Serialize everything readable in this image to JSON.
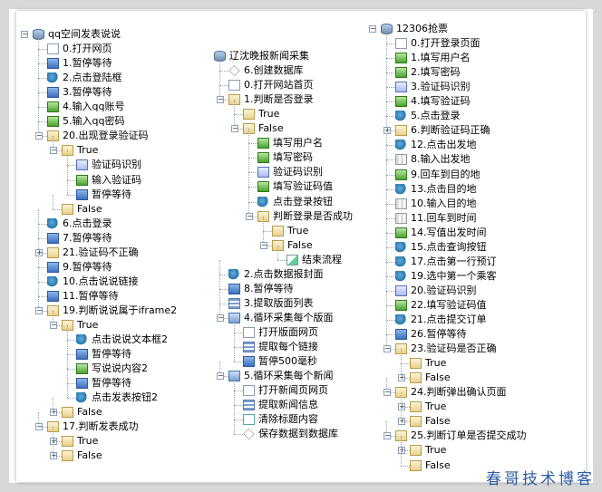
{
  "watermark": "春哥技术博客",
  "trees": [
    {
      "rows": [
        {
          "t": "qq空间发表说说",
          "icon": "db",
          "lvl": 0,
          "exp": "-"
        },
        {
          "t": "0.打开网页",
          "icon": "doc",
          "lvl": 1
        },
        {
          "t": "1.暂停等待",
          "icon": "pause",
          "lvl": 1
        },
        {
          "t": "2.点击登陆框",
          "icon": "click",
          "lvl": 1
        },
        {
          "t": "3.暂停等待",
          "icon": "pause",
          "lvl": 1
        },
        {
          "t": "4.输入qq账号",
          "icon": "green",
          "lvl": 1
        },
        {
          "t": "5.输入qq密码",
          "icon": "green",
          "lvl": 1
        },
        {
          "t": "20.出现登录验证码",
          "icon": "folder",
          "lvl": 1,
          "exp": "-"
        },
        {
          "t": "True",
          "icon": "folder",
          "lvl": 2,
          "exp": "-"
        },
        {
          "t": "验证码识别",
          "icon": "captcha",
          "lvl": 3
        },
        {
          "t": "输入验证码",
          "icon": "green",
          "lvl": 3
        },
        {
          "t": "暂停等待",
          "icon": "pause",
          "lvl": 3
        },
        {
          "t": "False",
          "icon": "folder",
          "lvl": 2
        },
        {
          "t": "6.点击登录",
          "icon": "click",
          "lvl": 1
        },
        {
          "t": "7.暂停等待",
          "icon": "pause",
          "lvl": 1
        },
        {
          "t": "21.验证码不正确",
          "icon": "folder",
          "lvl": 1,
          "exp": "+"
        },
        {
          "t": "9.暂停等待",
          "icon": "pause",
          "lvl": 1
        },
        {
          "t": "10.点击说说链接",
          "icon": "click",
          "lvl": 1
        },
        {
          "t": "11.暂停等待",
          "icon": "pause",
          "lvl": 1
        },
        {
          "t": "19.判断说说属于iframe2",
          "icon": "folder",
          "lvl": 1,
          "exp": "-"
        },
        {
          "t": "True",
          "icon": "folder",
          "lvl": 2,
          "exp": "-"
        },
        {
          "t": "点击说说文本框2",
          "icon": "click",
          "lvl": 3
        },
        {
          "t": "暂停等待",
          "icon": "pause",
          "lvl": 3
        },
        {
          "t": "写说说内容2",
          "icon": "green",
          "lvl": 3
        },
        {
          "t": "暂停等待",
          "icon": "pause",
          "lvl": 3
        },
        {
          "t": "点击发表按钮2",
          "icon": "click",
          "lvl": 3
        },
        {
          "t": "False",
          "icon": "folder",
          "lvl": 2,
          "exp": "+"
        },
        {
          "t": "17.判断发表成功",
          "icon": "folder",
          "lvl": 1,
          "exp": "-"
        },
        {
          "t": "True",
          "icon": "folder",
          "lvl": 2,
          "exp": "+"
        },
        {
          "t": "False",
          "icon": "folder",
          "lvl": 2,
          "exp": "+"
        }
      ]
    },
    {
      "rows": [
        {
          "t": "辽沈晚报新闻采集",
          "icon": "db",
          "lvl": 0
        },
        {
          "t": "6.创建数据库",
          "icon": "diamond",
          "lvl": 1
        },
        {
          "t": "0.打开网站首页",
          "icon": "doc",
          "lvl": 1
        },
        {
          "t": "1.判断是否登录",
          "icon": "folder",
          "lvl": 1,
          "exp": "-"
        },
        {
          "t": "True",
          "icon": "folder",
          "lvl": 2
        },
        {
          "t": "False",
          "icon": "folder",
          "lvl": 2,
          "exp": "-"
        },
        {
          "t": "填写用户名",
          "icon": "green",
          "lvl": 3
        },
        {
          "t": "填写密码",
          "icon": "green",
          "lvl": 3
        },
        {
          "t": "验证码识别",
          "icon": "captcha",
          "lvl": 3
        },
        {
          "t": "填写验证码值",
          "icon": "green",
          "lvl": 3
        },
        {
          "t": "点击登录按钮",
          "icon": "click",
          "lvl": 3
        },
        {
          "t": "判断登录是否成功",
          "icon": "folder",
          "lvl": 3,
          "exp": "-"
        },
        {
          "t": "True",
          "icon": "folder",
          "lvl": 4
        },
        {
          "t": "False",
          "icon": "folder",
          "lvl": 4,
          "exp": "-"
        },
        {
          "t": "结束流程",
          "icon": "chart",
          "lvl": 5
        },
        {
          "t": "2.点击数据报封面",
          "icon": "click",
          "lvl": 1
        },
        {
          "t": "8.暂停等待",
          "icon": "pause",
          "lvl": 1
        },
        {
          "t": "3.提取版面列表",
          "icon": "list",
          "lvl": 1
        },
        {
          "t": "4.循环采集每个版面",
          "icon": "loop",
          "lvl": 1,
          "exp": "-"
        },
        {
          "t": "打开版面网页",
          "icon": "doc",
          "lvl": 2
        },
        {
          "t": "提取每个链接",
          "icon": "list",
          "lvl": 2
        },
        {
          "t": "暂停500毫秒",
          "icon": "pause",
          "lvl": 2
        },
        {
          "t": "5.循环采集每个新闻",
          "icon": "loop",
          "lvl": 1,
          "exp": "-"
        },
        {
          "t": "打开新闻页网页",
          "icon": "doc",
          "lvl": 2
        },
        {
          "t": "提取新闻信息",
          "icon": "list",
          "lvl": 2
        },
        {
          "t": "清除标题内容",
          "icon": "x",
          "lvl": 2
        },
        {
          "t": "保存数据到数据库",
          "icon": "diamond",
          "lvl": 2
        }
      ]
    },
    {
      "rows": [
        {
          "t": "12306抢票",
          "icon": "db",
          "lvl": 0,
          "exp": "-"
        },
        {
          "t": "0.打开登录页面",
          "icon": "doc",
          "lvl": 1
        },
        {
          "t": "1.填写用户名",
          "icon": "green",
          "lvl": 1
        },
        {
          "t": "2.填写密码",
          "icon": "green",
          "lvl": 1
        },
        {
          "t": "3.验证码识别",
          "icon": "captcha",
          "lvl": 1
        },
        {
          "t": "4.填写验证码",
          "icon": "green",
          "lvl": 1
        },
        {
          "t": "5.点击登录",
          "icon": "click",
          "lvl": 1
        },
        {
          "t": "6.判断验证码正确",
          "icon": "folder",
          "lvl": 1,
          "exp": "+"
        },
        {
          "t": "12.点击出发地",
          "icon": "click",
          "lvl": 1
        },
        {
          "t": "8.输入出发地",
          "icon": "table",
          "lvl": 1
        },
        {
          "t": "9.回车到目的地",
          "icon": "green",
          "lvl": 1
        },
        {
          "t": "13.点击目的地",
          "icon": "click",
          "lvl": 1
        },
        {
          "t": "10.输入目的地",
          "icon": "table",
          "lvl": 1
        },
        {
          "t": "11.回车到时间",
          "icon": "table",
          "lvl": 1
        },
        {
          "t": "14.写值出发时间",
          "icon": "green",
          "lvl": 1
        },
        {
          "t": "15.点击查询按钮",
          "icon": "click",
          "lvl": 1
        },
        {
          "t": "17.点击第一行预订",
          "icon": "click",
          "lvl": 1
        },
        {
          "t": "19.选中第一个乘客",
          "icon": "click",
          "lvl": 1
        },
        {
          "t": "20.验证码识别",
          "icon": "captcha",
          "lvl": 1
        },
        {
          "t": "22.填写验证码值",
          "icon": "green",
          "lvl": 1
        },
        {
          "t": "21.点击提交订单",
          "icon": "click",
          "lvl": 1
        },
        {
          "t": "26.暂停等待",
          "icon": "pause",
          "lvl": 1
        },
        {
          "t": "23.验证码是否正确",
          "icon": "folder",
          "lvl": 1,
          "exp": "-"
        },
        {
          "t": "True",
          "icon": "folder",
          "lvl": 2
        },
        {
          "t": "False",
          "icon": "folder",
          "lvl": 2,
          "exp": "+"
        },
        {
          "t": "24.判断弹出确认页面",
          "icon": "folder",
          "lvl": 1,
          "exp": "-"
        },
        {
          "t": "True",
          "icon": "folder",
          "lvl": 2,
          "exp": "+"
        },
        {
          "t": "False",
          "icon": "folder",
          "lvl": 2,
          "exp": "+"
        },
        {
          "t": "25.判断订单是否提交成功",
          "icon": "folder",
          "lvl": 1,
          "exp": "-"
        },
        {
          "t": "True",
          "icon": "folder",
          "lvl": 2,
          "exp": "+"
        },
        {
          "t": "False",
          "icon": "folder",
          "lvl": 2
        }
      ]
    }
  ]
}
